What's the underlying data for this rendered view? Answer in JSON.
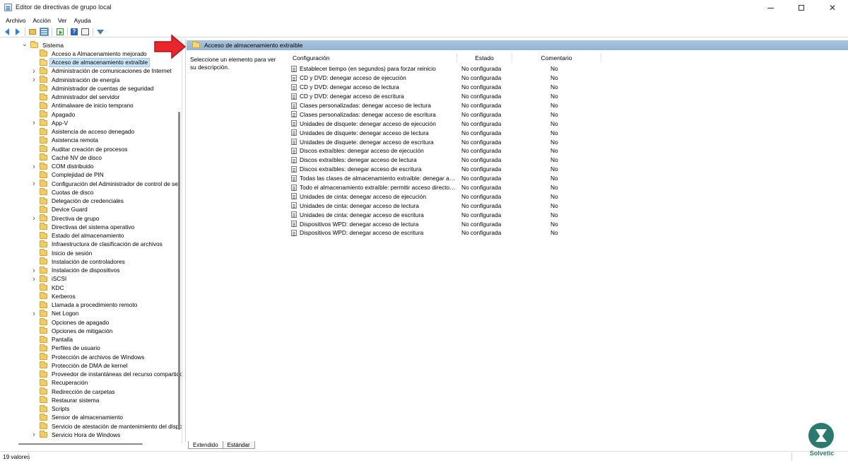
{
  "window": {
    "title": "Editor de directivas de grupo local",
    "controls": {
      "minimize": "—",
      "maximize": "☐",
      "close": "✕"
    }
  },
  "menu": [
    "Archivo",
    "Acción",
    "Ver",
    "Ayuda"
  ],
  "toolbar_icons": [
    "back-icon",
    "forward-icon",
    "up-folder-icon",
    "show-hide-tree-icon",
    "export-list-icon",
    "help-icon",
    "properties-icon",
    "filter-icon"
  ],
  "tree": {
    "root": "Sistema",
    "items": [
      {
        "label": "Acceso a Almacenamiento mejorado",
        "expandable": false
      },
      {
        "label": "Acceso de almacenamiento extraíble",
        "expandable": false,
        "selected": true
      },
      {
        "label": "Administración de comunicaciones de Internet",
        "expandable": true
      },
      {
        "label": "Administración de energía",
        "expandable": true
      },
      {
        "label": "Administrador de cuentas de seguridad",
        "expandable": false
      },
      {
        "label": "Administrador del servidor",
        "expandable": false
      },
      {
        "label": "Antimalware de inicio temprano",
        "expandable": false
      },
      {
        "label": "Apagado",
        "expandable": false
      },
      {
        "label": "App-V",
        "expandable": true
      },
      {
        "label": "Asistencia de acceso denegado",
        "expandable": false
      },
      {
        "label": "Asistencia remota",
        "expandable": false
      },
      {
        "label": "Auditar creación de procesos",
        "expandable": false
      },
      {
        "label": "Caché NV de disco",
        "expandable": false
      },
      {
        "label": "COM distribuido",
        "expandable": true
      },
      {
        "label": "Complejidad de PIN",
        "expandable": false
      },
      {
        "label": "Configuración del Administrador de control de se",
        "expandable": true
      },
      {
        "label": "Cuotas de disco",
        "expandable": false
      },
      {
        "label": "Delegación de credenciales",
        "expandable": false
      },
      {
        "label": "Device Guard",
        "expandable": false
      },
      {
        "label": "Directiva de grupo",
        "expandable": true
      },
      {
        "label": "Directivas del sistema operativo",
        "expandable": false
      },
      {
        "label": "Estado del almacenamiento",
        "expandable": false
      },
      {
        "label": "Infraestructura de clasificación de archivos",
        "expandable": false
      },
      {
        "label": "Inicio de sesión",
        "expandable": false
      },
      {
        "label": "Instalación de controladores",
        "expandable": false
      },
      {
        "label": "Instalación de dispositivos",
        "expandable": true
      },
      {
        "label": "iSCSI",
        "expandable": true
      },
      {
        "label": "KDC",
        "expandable": false
      },
      {
        "label": "Kerberos",
        "expandable": false
      },
      {
        "label": "Llamada a procedimiento remoto",
        "expandable": false
      },
      {
        "label": "Net Logon",
        "expandable": true
      },
      {
        "label": "Opciones de apagado",
        "expandable": false
      },
      {
        "label": "Opciones de mitigación",
        "expandable": false
      },
      {
        "label": "Pantalla",
        "expandable": false
      },
      {
        "label": "Perfiles de usuario",
        "expandable": false
      },
      {
        "label": "Protección de archivos de Windows",
        "expandable": false
      },
      {
        "label": "Protección de DMA de kernel",
        "expandable": false
      },
      {
        "label": "Proveedor de instantáneas del recurso compartido",
        "expandable": false
      },
      {
        "label": "Recuperación",
        "expandable": false
      },
      {
        "label": "Redirección de carpetas",
        "expandable": false
      },
      {
        "label": "Restaurar sistema",
        "expandable": false
      },
      {
        "label": "Scripts",
        "expandable": false
      },
      {
        "label": "Sensor de almacenamiento",
        "expandable": false
      },
      {
        "label": "Servicio de atestación de mantenimiento del dispo",
        "expandable": false
      },
      {
        "label": "Servicio Hora de Windows",
        "expandable": true
      }
    ]
  },
  "content": {
    "header": "Acceso de almacenamiento extraíble",
    "description": "Seleccione un elemento para ver su descripción.",
    "columns": {
      "config": "Configuración",
      "state": "Estado",
      "comment": "Comentario"
    },
    "policies": [
      {
        "name": "Establecer tiempo (en segundos) para forzar reinicio",
        "state": "No configurada",
        "comment": "No"
      },
      {
        "name": "CD y DVD: denegar acceso de ejecución",
        "state": "No configurada",
        "comment": "No"
      },
      {
        "name": "CD y DVD: denegar acceso de lectura",
        "state": "No configurada",
        "comment": "No"
      },
      {
        "name": "CD y DVD: denegar acceso de escritura",
        "state": "No configurada",
        "comment": "No"
      },
      {
        "name": "Clases personalizadas: denegar acceso de lectura",
        "state": "No configurada",
        "comment": "No"
      },
      {
        "name": "Clases personalizadas: denegar acceso de escritura",
        "state": "No configurada",
        "comment": "No"
      },
      {
        "name": "Unidades de disquete: denegar acceso de ejecución",
        "state": "No configurada",
        "comment": "No"
      },
      {
        "name": "Unidades de disquete: denegar acceso de lectura",
        "state": "No configurada",
        "comment": "No"
      },
      {
        "name": "Unidades de disquete: denegar acceso de escritura",
        "state": "No configurada",
        "comment": "No"
      },
      {
        "name": "Discos extraíbles: denegar acceso de ejecución",
        "state": "No configurada",
        "comment": "No"
      },
      {
        "name": "Discos extraíbles: denegar acceso de lectura",
        "state": "No configurada",
        "comment": "No"
      },
      {
        "name": "Discos extraíbles: denegar acceso de escritura",
        "state": "No configurada",
        "comment": "No"
      },
      {
        "name": "Todas las clases de almacenamiento extraíble: denegar acce...",
        "state": "No configurada",
        "comment": "No"
      },
      {
        "name": "Todo el almacenamiento extraíble: permitir acceso directo e...",
        "state": "No configurada",
        "comment": "No"
      },
      {
        "name": "Unidades de cinta: denegar acceso de ejecución",
        "state": "No configurada",
        "comment": "No"
      },
      {
        "name": "Unidades de cinta: denegar acceso de lectura",
        "state": "No configurada",
        "comment": "No"
      },
      {
        "name": "Unidades de cinta: denegar acceso de escritura",
        "state": "No configurada",
        "comment": "No"
      },
      {
        "name": "Dispositivos WPD: denegar acceso de lectura",
        "state": "No configurada",
        "comment": "No"
      },
      {
        "name": "Dispositivos WPD: denegar acceso de escritura",
        "state": "No configurada",
        "comment": "No"
      }
    ]
  },
  "tabs": [
    "Extendido",
    "Estándar"
  ],
  "status": {
    "text": "19 valores"
  },
  "watermark": {
    "text": "Solvetic"
  },
  "colors": {
    "header_bar": "#a9c4dd",
    "selection": "#cce4f7",
    "folder": "#f3cb63",
    "arrow": "#e8262b",
    "watermark": "#2a7a6f"
  }
}
